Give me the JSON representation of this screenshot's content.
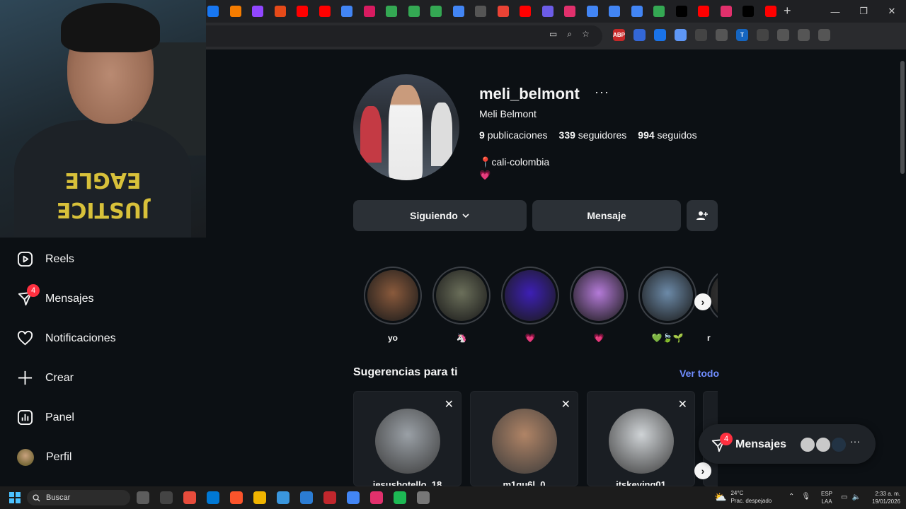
{
  "browser": {
    "tab_icon_colors": [
      "#1877f2",
      "#f57c00",
      "#9146ff",
      "#e64a19",
      "#ff0000",
      "#ff0000",
      "#4285f4",
      "#d81b60",
      "#34a853",
      "#34a853",
      "#34a853",
      "#4285f4",
      "#555555",
      "#ea4335",
      "#ff0000",
      "#6c5ce7",
      "#e1306c",
      "#4285f4",
      "#4285f4",
      "#4285f4",
      "#34a853",
      "#000000",
      "#ff0000",
      "#e1306c",
      "#000000",
      "#ff0000"
    ],
    "new_tab_symbol": "+",
    "window_buttons": [
      "—",
      "❐",
      "✕"
    ],
    "extension_labels": [
      "ABP",
      "",
      "",
      "",
      "",
      "",
      "T",
      "",
      "",
      "",
      ""
    ]
  },
  "sidebar": {
    "items": [
      {
        "label": "Reels",
        "icon": "reels-icon"
      },
      {
        "label": "Mensajes",
        "icon": "messenger-icon",
        "badge": "4"
      },
      {
        "label": "Notificaciones",
        "icon": "heart-icon"
      },
      {
        "label": "Crear",
        "icon": "plus-icon"
      },
      {
        "label": "Panel",
        "icon": "chart-icon"
      },
      {
        "label": "Perfil",
        "icon": "avatar"
      }
    ]
  },
  "profile": {
    "username": "meli_belmont",
    "more": "···",
    "full_name": "Meli Belmont",
    "posts_count": "9",
    "posts_label": "publicaciones",
    "followers_count": "339",
    "followers_label": "seguidores",
    "following_count": "994",
    "following_label": "seguidos",
    "bio_location": "cali-colombia",
    "bio_emoji": "💗"
  },
  "buttons": {
    "following": "Siguiendo",
    "message": "Mensaje"
  },
  "highlights": [
    {
      "label": "yo",
      "color": "#8a5a3c"
    },
    {
      "label": "🦄",
      "color": "#6b6f5a"
    },
    {
      "label": "💗",
      "color": "#3d1fb5"
    },
    {
      "label": "💗",
      "color": "#b47ad8"
    },
    {
      "label": "💚🍃🌱",
      "color": "#6c8aa8"
    },
    {
      "label": "r",
      "color": "#444"
    }
  ],
  "suggestions": {
    "title": "Sugerencias para ti",
    "see_all": "Ver todo",
    "cards": [
      {
        "name": "jesusbotello_18",
        "color": "#9aa0a6"
      },
      {
        "name": "m1gu6l_0",
        "color": "#b08466"
      },
      {
        "name": "itskevinq01",
        "color": "#cfd3d6"
      }
    ]
  },
  "messages_bar": {
    "label": "Mensajes",
    "badge": "4",
    "more": "···"
  },
  "taskbar": {
    "search_placeholder": "Buscar",
    "temperature": "24°C",
    "weather": "Prac. despejado",
    "lang_line1": "ESP",
    "lang_line2": "LAA",
    "time": "2:33 a. m.",
    "date": "19/01/2026",
    "app_colors": [
      "#5d5d5d",
      "#444444",
      "#e74c3c",
      "#0078d4",
      "#fb542b",
      "#f0b400",
      "#3a96dd",
      "#2b7cd3",
      "#c1272d",
      "#4285f4",
      "#e1306c",
      "#1db954",
      "#777777"
    ]
  }
}
